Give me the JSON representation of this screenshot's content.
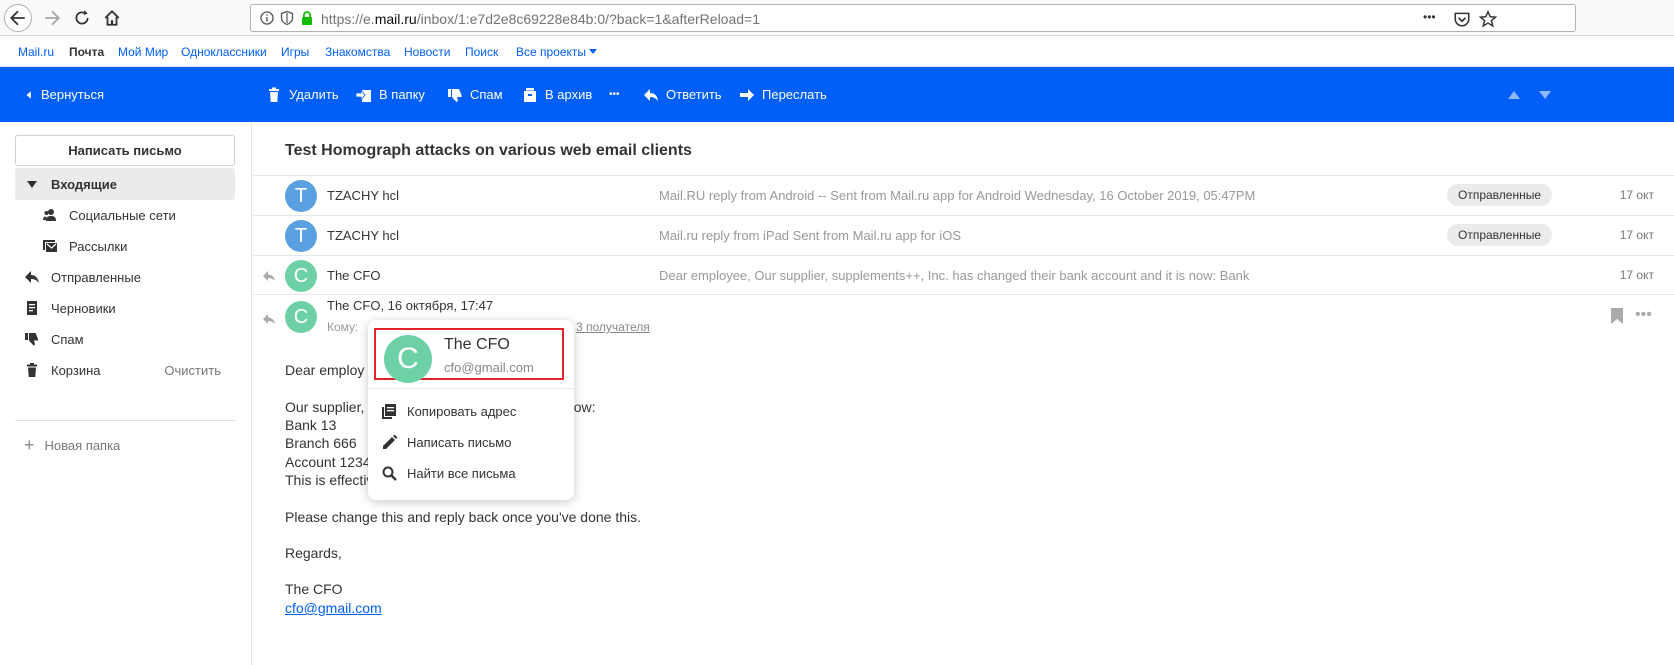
{
  "browser": {
    "url_prefix": "https://e.",
    "url_domain": "mail.ru",
    "url_path": "/inbox/1:e7d2e8c69228e84b:0/?back=1&afterReload=1",
    "overflow_glyph": "•••"
  },
  "portal_nav": [
    {
      "label": "Mail.ru"
    },
    {
      "label": "Почта"
    },
    {
      "label": "Мой Мир"
    },
    {
      "label": "Одноклассники"
    },
    {
      "label": "Игры"
    },
    {
      "label": "Знакомства"
    },
    {
      "label": "Новости"
    },
    {
      "label": "Поиск"
    },
    {
      "label": "Все проекты"
    }
  ],
  "toolbar": {
    "back_label": "Вернуться",
    "delete_label": "Удалить",
    "move_label": "В папку",
    "spam_label": "Спам",
    "archive_label": "В архив",
    "more_glyph": "•••",
    "reply_label": "Ответить",
    "forward_label": "Переслать",
    "color": "#005ff9"
  },
  "sidebar": {
    "compose_label": "Написать письмо",
    "folders": [
      {
        "label": "Входящие",
        "icon": "caret-down-icon"
      },
      {
        "label": "Социальные сети",
        "icon": "people-icon"
      },
      {
        "label": "Рассылки",
        "icon": "newsletter-icon"
      },
      {
        "label": "Отправленные",
        "icon": "reply-icon"
      },
      {
        "label": "Черновики",
        "icon": "draft-icon"
      },
      {
        "label": "Спам",
        "icon": "thumb-down-icon"
      },
      {
        "label": "Корзина",
        "icon": "trash-icon",
        "action": "Очистить"
      }
    ],
    "new_folder_label": "Новая папка"
  },
  "thread": {
    "subject": "Test Homograph attacks on various web email clients",
    "rows": [
      {
        "initial": "T",
        "sender": "TZACHY hcl",
        "snippet": "Mail.RU reply from Android -- Sent from Mail.ru app for Android Wednesday, 16 October 2019, 05:47PM",
        "badge": "Отправленные",
        "date": "17 окт"
      },
      {
        "initial": "T",
        "sender": "TZACHY hcl",
        "snippet": "Mail.ru reply from iPad Sent from Mail.ru app for iOS",
        "badge": "Отправленные",
        "date": "17 окт"
      },
      {
        "initial": "C",
        "sender": "The CFO",
        "snippet": "Dear employee, Our supplier, supplements++, Inc. has changed their bank account and it is now: Bank",
        "date": "17 окт"
      }
    ]
  },
  "message": {
    "initial": "C",
    "sender_line": "The CFO, 16 октября, 17:47",
    "to_line": "Кому: ",
    "recipients_tail": "3 получателя",
    "body": [
      "Dear employ",
      "Our supplier,                           ged their bank account and it is now:",
      "Bank 13",
      "Branch 666",
      "Account 1234",
      "This is effective from now.",
      "Please change this and reply back once you've done this.",
      "Regards,",
      "The CFO"
    ],
    "signature_email": "cfo@gmail.com"
  },
  "popup": {
    "initial": "C",
    "name": "The CFO",
    "email": "cfo@gmail.com",
    "items": [
      {
        "label": "Копировать адрес",
        "icon": "copy-icon"
      },
      {
        "label": "Написать письмо",
        "icon": "pencil-icon"
      },
      {
        "label": "Найти все письма",
        "icon": "search-icon"
      }
    ],
    "highlight_color": "#e0242a"
  },
  "colors": {
    "avatar_blue": "#5ba0e0",
    "avatar_green": "#6ed1a5",
    "link": "#005ff9"
  }
}
